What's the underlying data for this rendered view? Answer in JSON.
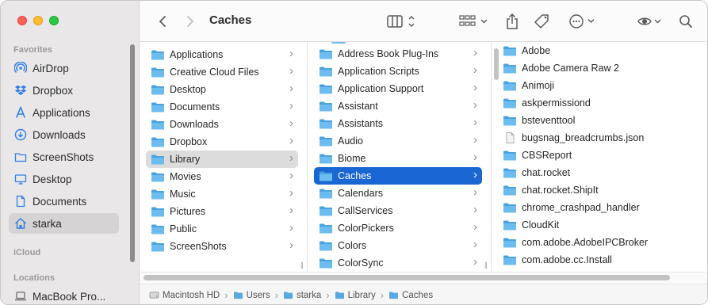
{
  "window": {
    "title": "Caches"
  },
  "sidebar": {
    "favorites_label": "Favorites",
    "favorites": [
      {
        "label": "AirDrop",
        "icon": "airdrop-icon"
      },
      {
        "label": "Dropbox",
        "icon": "dropbox-icon"
      },
      {
        "label": "Applications",
        "icon": "applications-icon"
      },
      {
        "label": "Downloads",
        "icon": "downloads-icon"
      },
      {
        "label": "ScreenShots",
        "icon": "folder-icon"
      },
      {
        "label": "Desktop",
        "icon": "desktop-icon"
      },
      {
        "label": "Documents",
        "icon": "document-icon"
      },
      {
        "label": "starka",
        "icon": "home-icon"
      }
    ],
    "icloud_label": "iCloud",
    "locations_label": "Locations",
    "locations": [
      {
        "label": "MacBook Pro...",
        "icon": "laptop-icon"
      }
    ]
  },
  "columns": {
    "col1": [
      "Applications",
      "Creative Cloud Files",
      "Desktop",
      "Documents",
      "Downloads",
      "Dropbox",
      "Library",
      "Movies",
      "Music",
      "Pictures",
      "Public",
      "ScreenShots"
    ],
    "col2_partial": "",
    "col2": [
      "Address Book Plug-Ins",
      "Application Scripts",
      "Application Support",
      "Assistant",
      "Assistants",
      "Audio",
      "Biome",
      "Caches",
      "Calendars",
      "CallServices",
      "ColorPickers",
      "Colors",
      "ColorSync"
    ],
    "col3": [
      "Adobe",
      "Adobe Camera Raw 2",
      "Animoji",
      "askpermissiond",
      "bsteventtool",
      "bugsnag_breadcrumbs.json",
      "CBSReport",
      "chat.rocket",
      "chat.rocket.ShipIt",
      "chrome_crashpad_handler",
      "CloudKit",
      "com.adobe.AdobeIPCBroker",
      "com.adobe.cc.Install"
    ]
  },
  "pathbar": [
    "Macintosh HD",
    "Users",
    "starka",
    "Library",
    "Caches"
  ],
  "colors": {
    "accent": "#1a66d2",
    "folder": "#5ab0e8"
  }
}
